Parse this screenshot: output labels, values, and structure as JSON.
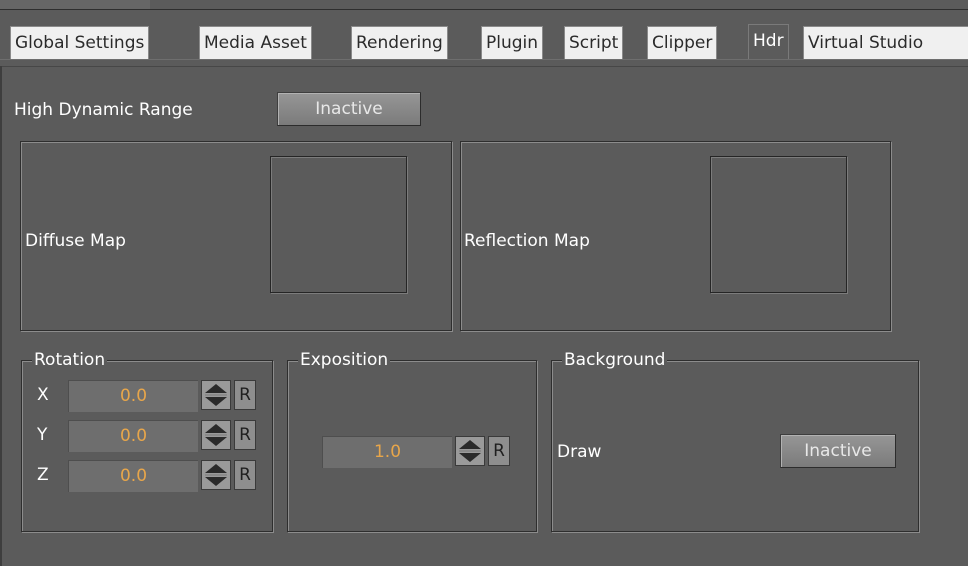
{
  "tabs": [
    {
      "label": "Global Settings"
    },
    {
      "label": "Media Asset"
    },
    {
      "label": "Rendering"
    },
    {
      "label": "Plugin"
    },
    {
      "label": "Script"
    },
    {
      "label": "Clipper"
    },
    {
      "label": "Hdr"
    },
    {
      "label": "Virtual Studio"
    }
  ],
  "active_tab": "Hdr",
  "hdr": {
    "label": "High Dynamic Range",
    "state": "Inactive"
  },
  "maps": {
    "diffuse_label": "Diffuse Map",
    "reflection_label": "Reflection Map"
  },
  "rotation": {
    "title": "Rotation",
    "axes": [
      {
        "axis": "X",
        "value": "0.0"
      },
      {
        "axis": "Y",
        "value": "0.0"
      },
      {
        "axis": "Z",
        "value": "0.0"
      }
    ]
  },
  "exposition": {
    "title": "Exposition",
    "value": "1.0"
  },
  "background": {
    "title": "Background",
    "draw_label": "Draw",
    "draw_state": "Inactive"
  },
  "reset_label": "R",
  "colors": {
    "panel_bg": "#5b5b5b",
    "value_text": "#e8a64a",
    "tab_bg": "#f0f0f0"
  }
}
